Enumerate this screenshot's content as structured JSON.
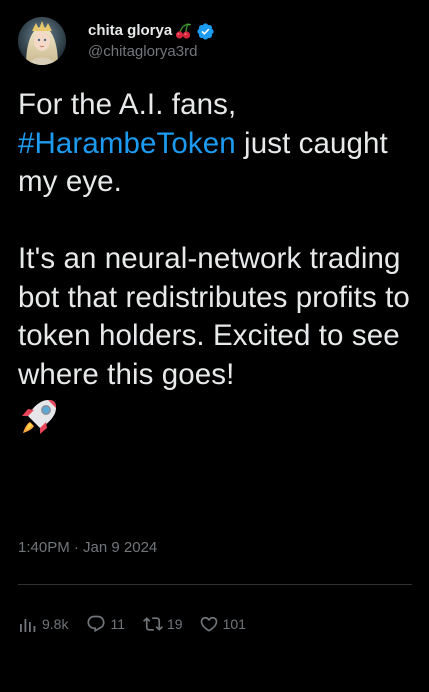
{
  "user": {
    "display_name": "chita glorya",
    "handle": "@chitaglorya3rd",
    "name_emoji": "cherries-icon",
    "verified": true
  },
  "tweet": {
    "line1_text": "For the A.I. fans,",
    "hashtag": "#HarambeToken",
    "after_hashtag": " just caught my eye.",
    "paragraph2": "It's an neural-network trading bot that redistributes profits to token holders. Excited to see where this goes!",
    "trailing_emoji": "rocket-icon",
    "timestamp": "1:40PM · Jan 9 2024"
  },
  "metrics": {
    "views": "9.8k",
    "replies": "11",
    "reposts": "19",
    "likes": "101"
  },
  "colors": {
    "background": "#000000",
    "text": "#e7e9ea",
    "muted": "#71767b",
    "link": "#1d9bf0",
    "verified": "#1d9bf0",
    "divider": "#2f3336"
  }
}
